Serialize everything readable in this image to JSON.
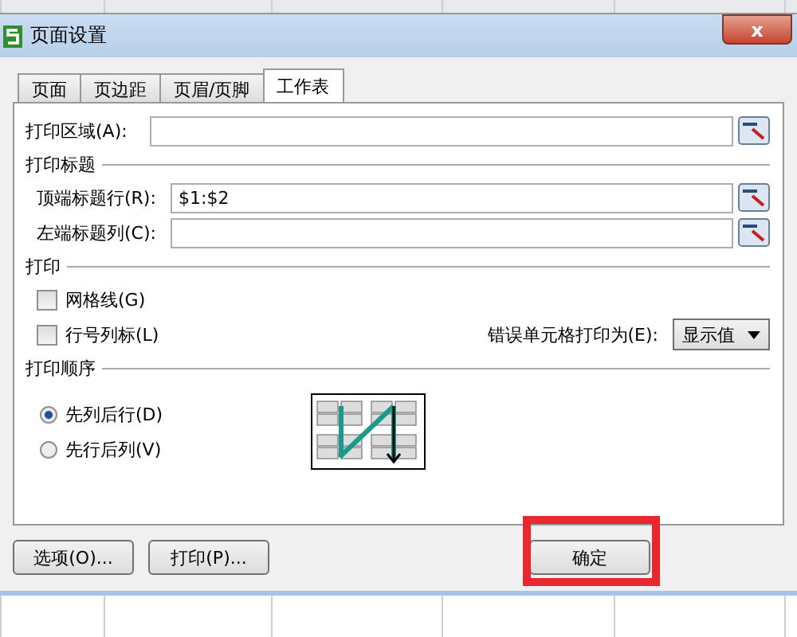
{
  "window": {
    "title": "页面设置",
    "close": "x"
  },
  "tabs": [
    {
      "label": "页面",
      "selected": false
    },
    {
      "label": "页边距",
      "selected": false
    },
    {
      "label": "页眉/页脚",
      "selected": false
    },
    {
      "label": "工作表",
      "selected": true
    }
  ],
  "print_area": {
    "label": "打印区域(A):"
  },
  "print_titles": {
    "heading": "打印标题",
    "fields": [
      {
        "label": "顶端标题行(R):",
        "value": "$1:$2"
      },
      {
        "label": "左端标题列(C):"
      }
    ]
  },
  "print": {
    "heading": "打印",
    "checkboxes": [
      {
        "label": "网格线(G)",
        "checked": false
      },
      {
        "label": "行号列标(L)",
        "checked": false
      }
    ],
    "errors_label": "错误单元格打印为(E):",
    "errors_value": "显示值"
  },
  "print_order": {
    "heading": "打印顺序",
    "options": [
      {
        "label": "先列后行(D)",
        "selected": true
      },
      {
        "label": "先行后列(V)",
        "selected": false
      }
    ]
  },
  "buttons": [
    {
      "label": "选项(O)...",
      "highlighted": false
    },
    {
      "label": "打印(P)...",
      "highlighted": false
    },
    {
      "label": "确定",
      "highlighted": true
    }
  ]
}
